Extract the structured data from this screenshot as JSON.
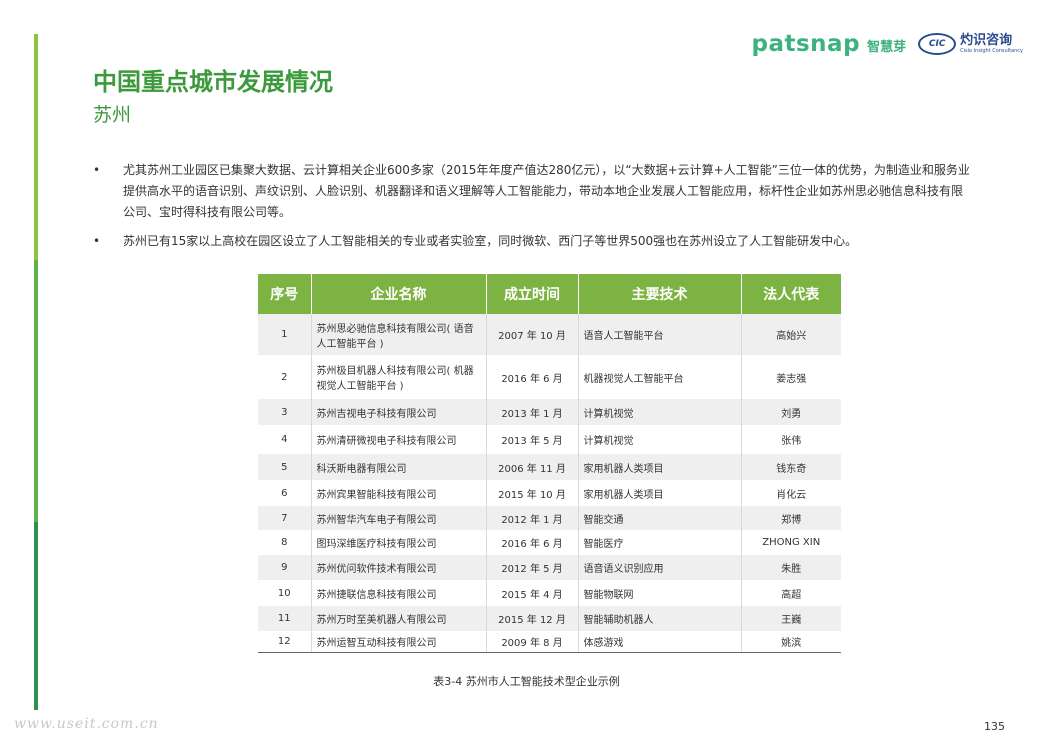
{
  "brand": {
    "patsnap": "patsnap",
    "patsnap_cn": "智慧芽",
    "cic_mark": "CIC",
    "cic_cn": "灼识咨询",
    "cic_en": "Cisio Insight Consultancy"
  },
  "title": "中国重点城市发展情况",
  "subtitle": "苏州",
  "bullets": [
    "尤其苏州工业园区已集聚大数据、云计算相关企业600多家（2015年年度产值达280亿元），以“大数据+云计算+人工智能”三位一体的优势，为制造业和服务业提供高水平的语音识别、声纹识别、人脸识别、机器翻译和语义理解等人工智能能力，带动本地企业发展人工智能应用，标杆性企业如苏州思必驰信息科技有限公司、宝时得科技有限公司等。",
    "苏州已有15家以上高校在园区设立了人工智能相关的专业或者实验室，同时微软、西门子等世界500强也在苏州设立了人工智能研发中心。"
  ],
  "bullet_symbol": "•",
  "table": {
    "headers": [
      "序号",
      "企业名称",
      "成立时间",
      "主要技术",
      "法人代表"
    ],
    "rows": [
      [
        "1",
        "苏州思必驰信息科技有限公司( 语音人工智能平台 )",
        "2007 年 10 月",
        "语音人工智能平台",
        "高始兴"
      ],
      [
        "2",
        "苏州极目机器人科技有限公司( 机器视觉人工智能平台 )",
        "2016 年 6 月",
        "机器视觉人工智能平台",
        "姜志强"
      ],
      [
        "3",
        "苏州吉视电子科技有限公司",
        "2013 年 1 月",
        "计算机视觉",
        "刘勇"
      ],
      [
        "4",
        "苏州清研微视电子科技有限公司",
        "2013 年 5 月",
        "计算机视觉",
        "张伟"
      ],
      [
        "5",
        "科沃斯电器有限公司",
        "2006 年 11 月",
        "家用机器人类项目",
        "钱东奇"
      ],
      [
        "6",
        "苏州宾果智能科技有限公司",
        "2015 年 10 月",
        "家用机器人类项目",
        "肖化云"
      ],
      [
        "7",
        "苏州智华汽车电子有限公司",
        "2012 年 1 月",
        "智能交通",
        "郑博"
      ],
      [
        "8",
        "图玛深维医疗科技有限公司",
        "2016 年 6 月",
        "智能医疗",
        "ZHONG XIN"
      ],
      [
        "9",
        "苏州优问软件技术有限公司",
        "2012 年 5 月",
        "语音语义识别应用",
        "朱胜"
      ],
      [
        "10",
        "苏州捷联信息科技有限公司",
        "2015 年 4 月",
        "智能物联网",
        "高超"
      ],
      [
        "11",
        "苏州万时至美机器人有限公司",
        "2015 年 12 月",
        "智能辅助机器人",
        "王巍"
      ],
      [
        "12",
        "苏州运智互动科技有限公司",
        "2009 年 8 月",
        "体感游戏",
        "姚滨"
      ]
    ]
  },
  "caption": "表3-4 苏州市人工智能技术型企业示例",
  "page_number": "135",
  "watermark": "www.useit.com.cn",
  "colors": {
    "title_green": "#3c9a3c",
    "header_green": "#7cb342",
    "patsnap_green": "#3cb27e",
    "cic_blue": "#2a4b8d"
  }
}
